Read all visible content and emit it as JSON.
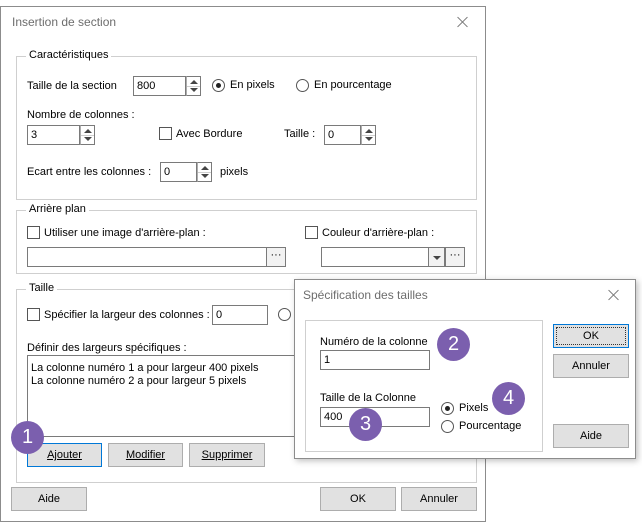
{
  "main": {
    "title": "Insertion de section",
    "caract": {
      "legend": "Caractéristiques",
      "taille_section_label": "Taille de la section",
      "taille_section_value": "800",
      "radio_pixels": "En pixels",
      "radio_pourcentage": "En pourcentage",
      "nb_colonnes_label": "Nombre de colonnes :",
      "nb_colonnes_value": "3",
      "avec_bordure": "Avec Bordure",
      "taille_label": "Taille :",
      "taille_value": "0",
      "ecart_label": "Ecart entre les colonnes :",
      "ecart_value": "0",
      "ecart_unit": "pixels"
    },
    "arriere": {
      "legend": "Arrière plan",
      "image_label": "Utiliser une image d'arrière-plan :",
      "image_value": "",
      "image_browse": "···",
      "couleur_label": "Couleur d'arrière-plan :",
      "couleur_browse": "···"
    },
    "taille": {
      "legend": "Taille",
      "specifier_label": "Spécifier la largeur des colonnes :",
      "specifier_value": "0",
      "definir_label": "Définir des largeurs spécifiques :",
      "list": [
        "La colonne numéro  1  a pour largeur  400 pixels",
        "La colonne numéro  2  a pour largeur  5 pixels"
      ],
      "btn_ajouter": "Ajouter",
      "btn_modifier": "Modifier",
      "btn_supprimer": "Supprimer"
    },
    "btn_aide": "Aide",
    "btn_ok": "OK",
    "btn_annuler": "Annuler"
  },
  "spec": {
    "title": "Spécification des tailles",
    "numero_label": "Numéro de la colonne",
    "numero_value": "1",
    "taille_label": "Taille de la Colonne",
    "taille_value": "400",
    "radio_pixels": "Pixels",
    "radio_pourcentage": "Pourcentage",
    "btn_ok": "OK",
    "btn_annuler": "Annuler",
    "btn_aide": "Aide"
  },
  "badges": [
    "1",
    "2",
    "3",
    "4"
  ],
  "colors": {
    "badge": "#7b5fae",
    "accent": "#0078d7"
  }
}
